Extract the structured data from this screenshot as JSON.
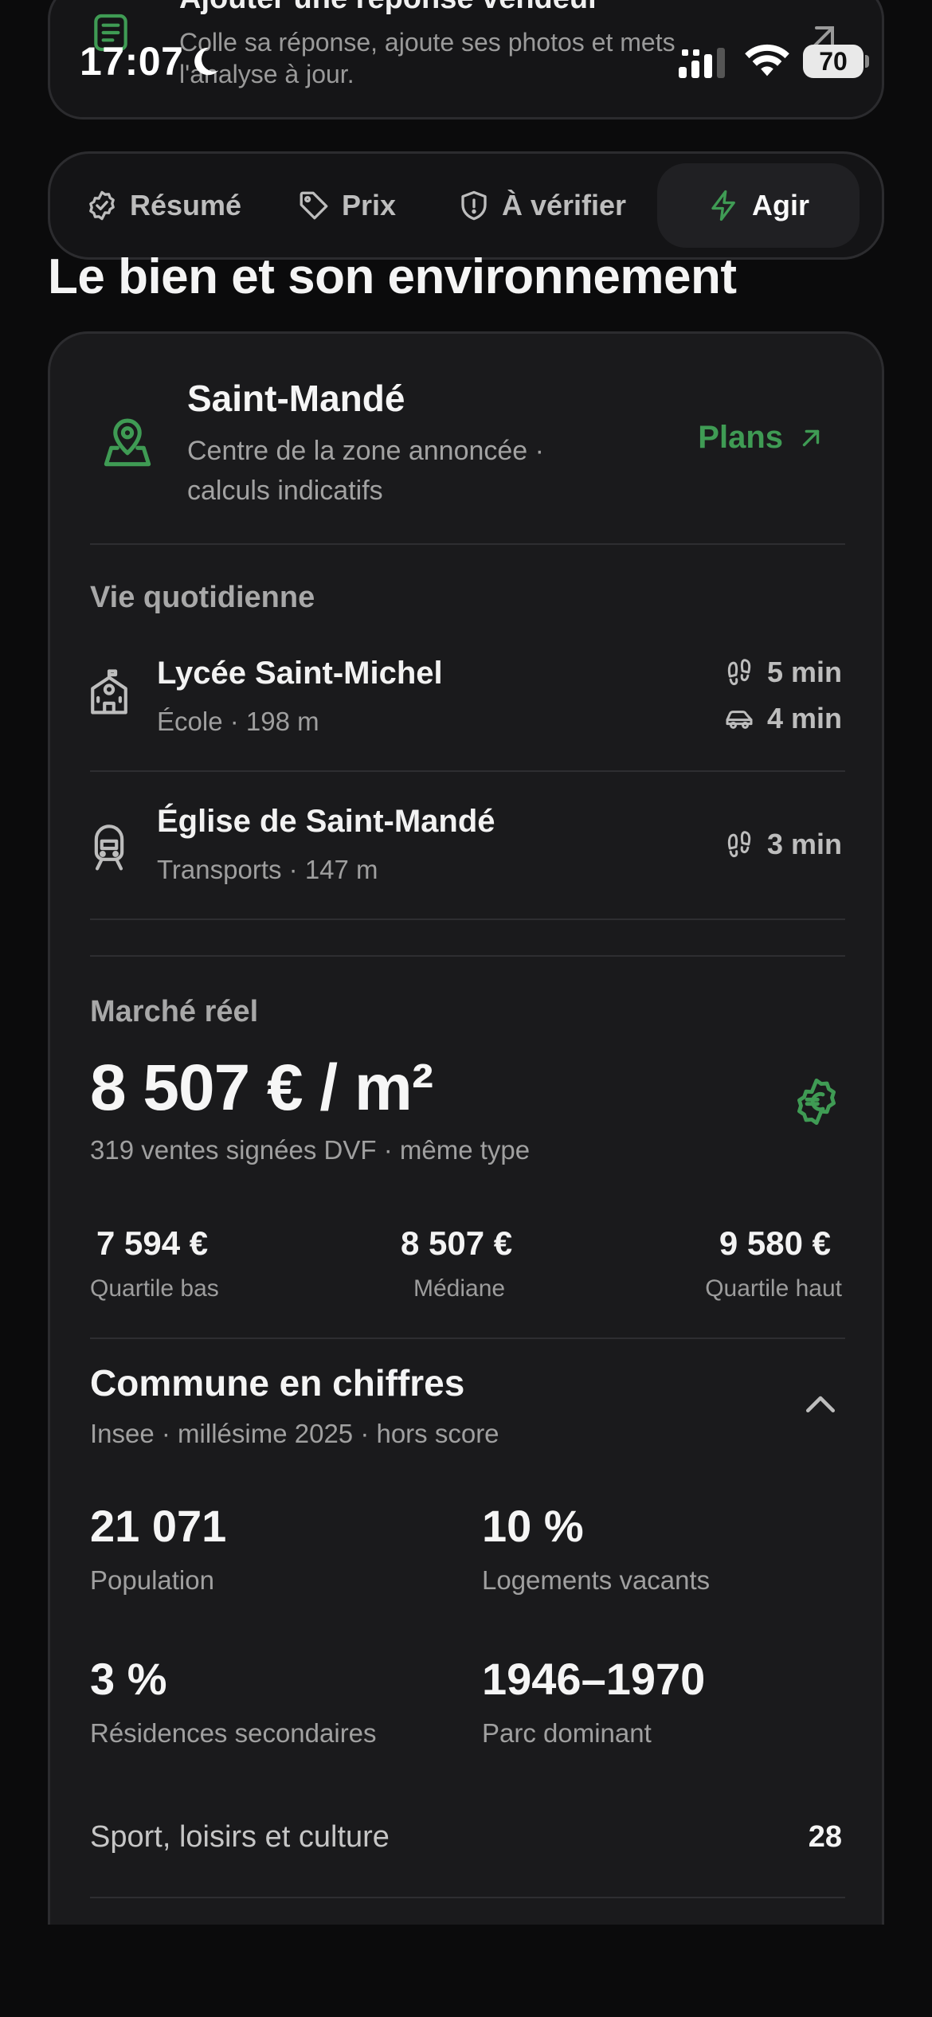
{
  "status_bar": {
    "time": "17:07",
    "battery": "70"
  },
  "top_card": {
    "title": "Ajouter une réponse vendeur",
    "subtitle": "Colle sa réponse, ajoute ses photos et mets l'analyse à jour."
  },
  "tabs": [
    {
      "label": "Résumé",
      "icon": "check-badge-icon",
      "active": false
    },
    {
      "label": "Prix",
      "icon": "tag-icon",
      "active": false
    },
    {
      "label": "À vérifier",
      "icon": "shield-alert-icon",
      "active": false
    },
    {
      "label": "Agir",
      "icon": "lightning-icon",
      "active": true
    }
  ],
  "section_title": "Le bien et son environnement",
  "location": {
    "title": "Saint-Mandé",
    "subtitle": "Centre de la zone annoncée · calculs indicatifs",
    "plans_label": "Plans"
  },
  "daily_life": {
    "heading": "Vie quotidienne",
    "items": [
      {
        "title": "Lycée Saint-Michel",
        "subtitle": "École · 198 m",
        "walk": "5 min",
        "drive": "4 min",
        "icon": "school-icon"
      },
      {
        "title": "Église de Saint-Mandé",
        "subtitle": "Transports · 147 m",
        "walk": "3 min",
        "icon": "train-icon"
      }
    ]
  },
  "market": {
    "heading": "Marché réel",
    "price": "8 507 € / m²",
    "subtitle": "319 ventes signées DVF · même type",
    "quartiles": [
      {
        "value": "7 594 €",
        "label": "Quartile bas"
      },
      {
        "value": "8 507 €",
        "label": "Médiane"
      },
      {
        "value": "9 580 €",
        "label": "Quartile haut"
      }
    ]
  },
  "commune": {
    "title": "Commune en chiffres",
    "subtitle": "Insee · millésime 2025 · hors score",
    "stats": [
      {
        "value": "21 071",
        "label": "Population"
      },
      {
        "value": "10 %",
        "label": "Logements vacants"
      },
      {
        "value": "3 %",
        "label": "Résidences secondaires"
      },
      {
        "value": "1946–1970",
        "label": "Parc dominant"
      }
    ],
    "rows": [
      {
        "label": "Sport, loisirs et culture",
        "count": "28"
      }
    ]
  },
  "colors": {
    "accent_green": "#3f9b54",
    "background": "#0b0b0c",
    "card": "#1a1a1c"
  }
}
